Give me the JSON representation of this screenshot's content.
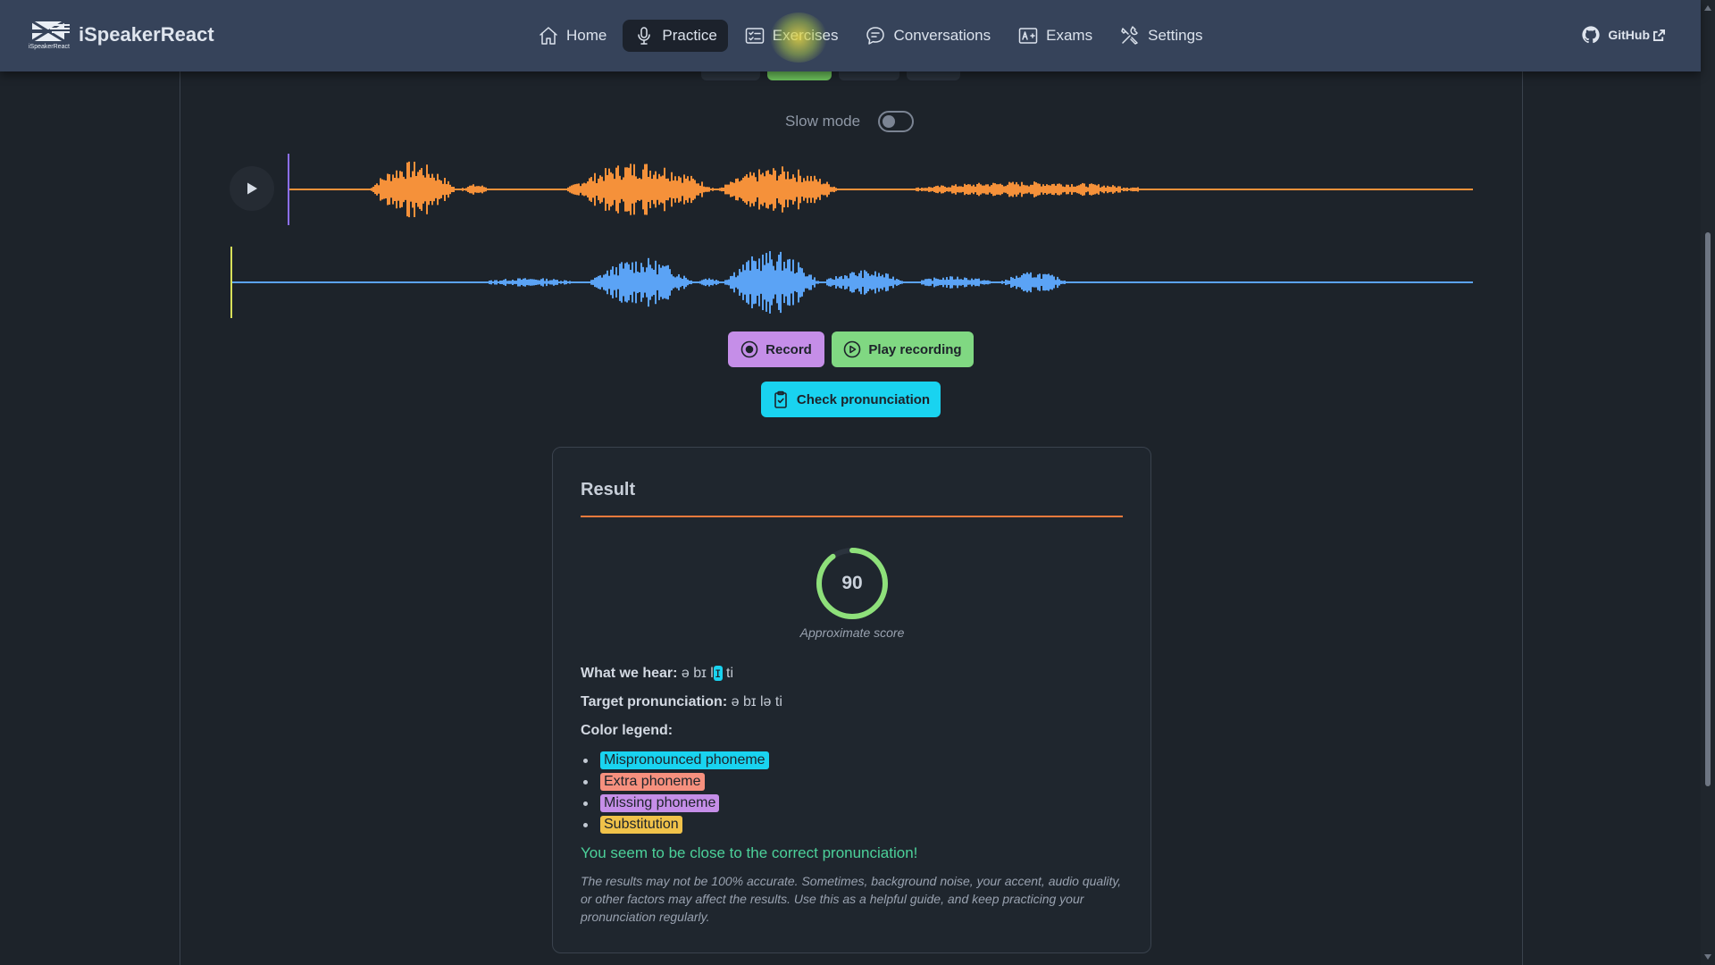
{
  "brand": {
    "logo_text": "iSpeakerReact",
    "name": "iSpeakerReact"
  },
  "nav": {
    "items": [
      {
        "label": "Home",
        "icon": "home-icon"
      },
      {
        "label": "Practice",
        "icon": "microphone-icon",
        "active": true
      },
      {
        "label": "Exercises",
        "icon": "exercises-icon"
      },
      {
        "label": "Conversations",
        "icon": "chat-bubble-icon"
      },
      {
        "label": "Exams",
        "icon": "exam-icon"
      },
      {
        "label": "Settings",
        "icon": "tools-icon"
      }
    ],
    "github_label": "GitHub"
  },
  "controls": {
    "slow_mode_label": "Slow mode",
    "slow_mode_on": false,
    "record_label": "Record",
    "play_recording_label": "Play recording",
    "check_label": "Check pronunciation"
  },
  "colors": {
    "model_wave": "#f5913a",
    "user_wave": "#5ba3f5",
    "record": "#c58ee8",
    "play": "#80d882",
    "check": "#19d3f0",
    "score_ring": "#8ee07a",
    "accent_line": "#f07a3c"
  },
  "result": {
    "title": "Result",
    "score": "90",
    "score_value": 90,
    "score_caption": "Approximate score",
    "hear_label": "What we hear:",
    "hear_before": "ə bɪ l",
    "hear_mispronounced": "ɪ",
    "hear_after": " ti",
    "target_label": "Target pronunciation:",
    "target_value": "ə bɪ lə ti",
    "legend_label": "Color legend:",
    "legend": {
      "mispronounced": "Mispronounced phoneme",
      "extra": "Extra phoneme",
      "missing": "Missing phoneme",
      "substitution": "Substitution"
    },
    "message": "You seem to be close to the correct pronunciation!",
    "disclaimer": "The results may not be 100% accurate. Sometimes, background noise, your accent, audio quality, or other factors may affect the results. Use this as a helpful guide, and keep practicing your pronunciation regularly."
  }
}
